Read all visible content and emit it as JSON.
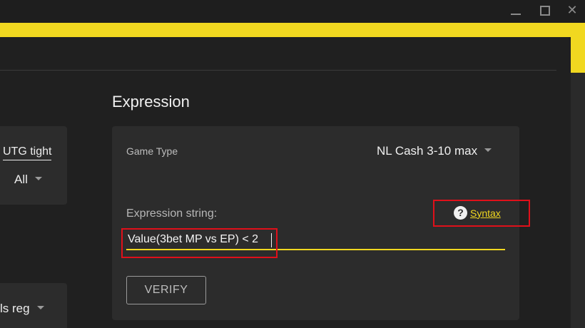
{
  "window": {
    "minimize_icon": "minimize-icon",
    "maximize_icon": "maximize-icon",
    "close_icon": "close-icon",
    "close_glyph": "✕"
  },
  "colors": {
    "accent": "#f1d820",
    "annotation": "#e0101a",
    "panel": "#202020",
    "card": "#2c2c2c"
  },
  "left_panel": {
    "card1_label": "UTG tight",
    "card1_select": "All",
    "card2_select": "ls reg"
  },
  "expression": {
    "title": "Expression",
    "game_type_label": "Game Type",
    "game_type_value": "NL Cash 3-10 max",
    "expression_label": "Expression string:",
    "help_glyph": "?",
    "syntax_link": "Syntax",
    "expression_value": "Value(3bet MP vs EP) < 2",
    "verify_button": "VERIFY"
  }
}
